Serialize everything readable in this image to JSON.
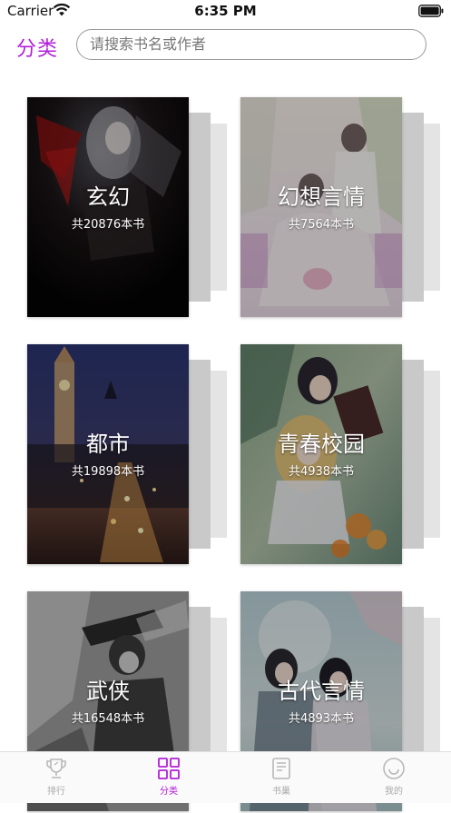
{
  "status_bar": {
    "carrier": "Carrier",
    "time": "6:35 PM"
  },
  "header": {
    "title": "分类",
    "search_placeholder": "请搜索书名或作者"
  },
  "categories": [
    {
      "name": "玄幻",
      "count": "共20876本书"
    },
    {
      "name": "幻想言情",
      "count": "共7564本书"
    },
    {
      "name": "都市",
      "count": "共19898本书"
    },
    {
      "name": "青春校园",
      "count": "共4938本书"
    },
    {
      "name": "武侠",
      "count": "共16548本书"
    },
    {
      "name": "古代言情",
      "count": "共4893本书"
    }
  ],
  "tabs": [
    {
      "label": "排行",
      "icon": "trophy-icon",
      "active": false
    },
    {
      "label": "分类",
      "icon": "grid-icon",
      "active": true
    },
    {
      "label": "书巢",
      "icon": "book-icon",
      "active": false
    },
    {
      "label": "我的",
      "icon": "smile-icon",
      "active": false
    }
  ],
  "colors": {
    "accent": "#b31ed9",
    "inactive_tab": "#aaaaaa"
  }
}
